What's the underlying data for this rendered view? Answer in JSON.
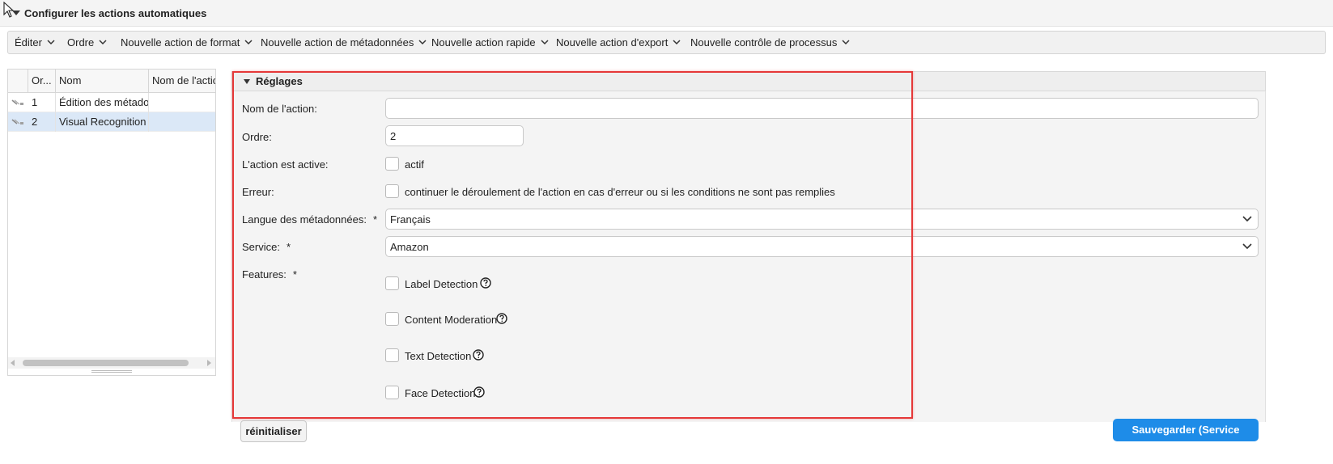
{
  "title": "Configurer les actions automatiques",
  "menubar": {
    "items": [
      "Éditer",
      "Ordre",
      "Nouvelle action de format",
      "Nouvelle action de métadonnées",
      "Nouvelle action rapide",
      "Nouvelle action d'export",
      "Nouvelle contrôle de processus"
    ]
  },
  "grid": {
    "columns": [
      "Or...",
      "Nom",
      "Nom de l'actio"
    ],
    "rows": [
      {
        "order": "1",
        "name": "Édition des métadon",
        "action_name": "",
        "selected": false
      },
      {
        "order": "2",
        "name": "Visual Recognition S",
        "action_name": "",
        "selected": true
      }
    ]
  },
  "panel": {
    "title": "Réglages",
    "fields": {
      "action_name": {
        "label": "Nom de l'action:",
        "value": ""
      },
      "order": {
        "label": "Ordre:",
        "value": "2"
      },
      "active": {
        "label": "L'action est active:",
        "checkbox_label": "actif",
        "checked": false
      },
      "error": {
        "label": "Erreur:",
        "checkbox_label": "continuer le déroulement de l'action en cas d'erreur ou si les conditions ne sont pas remplies",
        "checked": false
      },
      "language": {
        "label": "Langue des métadonnées:",
        "required": "*",
        "value": "Français"
      },
      "service": {
        "label": "Service:",
        "required": "*",
        "value": "Amazon"
      },
      "features": {
        "label": "Features:",
        "required": "*",
        "items": [
          {
            "label": "Label Detection",
            "checked": false
          },
          {
            "label": "Content Moderation",
            "checked": false
          },
          {
            "label": "Text Detection",
            "checked": false
          },
          {
            "label": "Face Detection",
            "checked": false
          }
        ]
      }
    }
  },
  "buttons": {
    "reset": "réinitialiser",
    "save": "Sauvegarder (Service payant)"
  },
  "colors": {
    "accent": "#1e8ce8",
    "highlight_box": "#e53838",
    "selected_row": "#dbe8f7"
  }
}
